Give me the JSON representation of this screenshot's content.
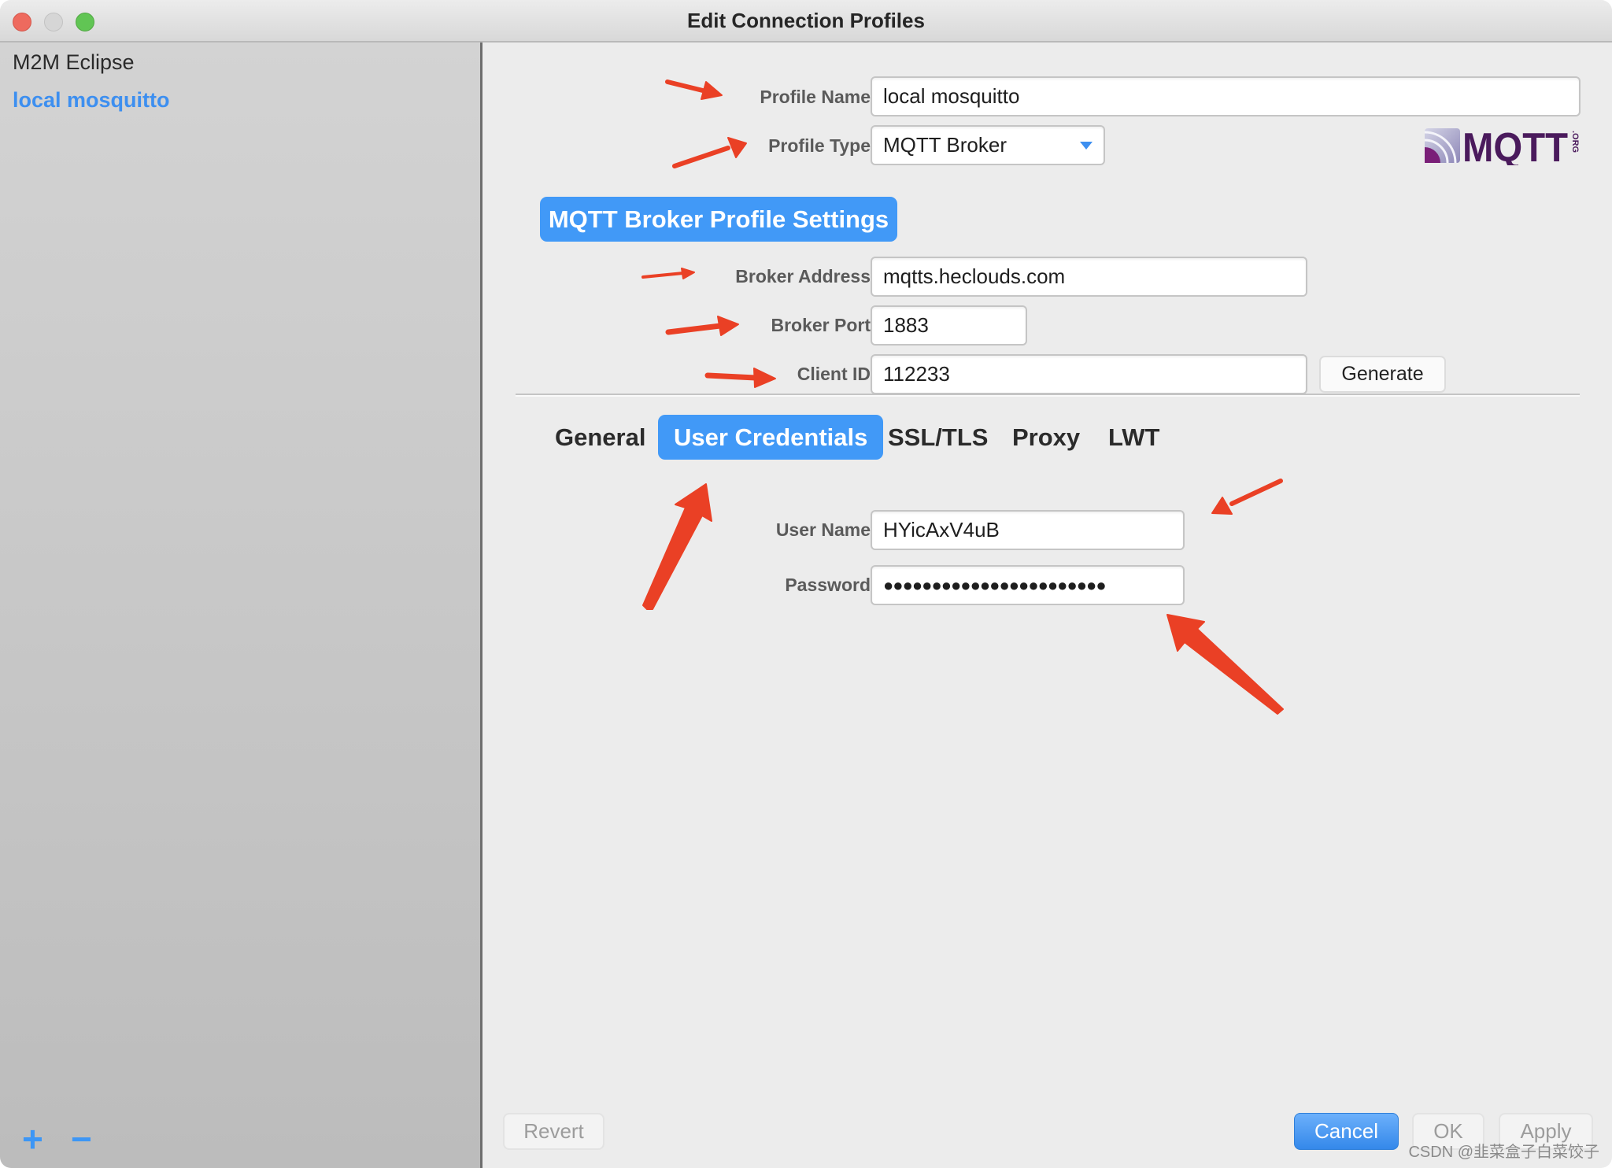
{
  "window": {
    "title": "Edit Connection Profiles",
    "traffic_lights": [
      "close",
      "minimize",
      "zoom"
    ]
  },
  "sidebar": {
    "items": [
      {
        "label": "M2M Eclipse",
        "selected": false
      },
      {
        "label": "local mosquitto",
        "selected": true
      }
    ],
    "add_icon": "+",
    "remove_icon": "−"
  },
  "profile": {
    "name_label": "Profile Name",
    "name_value": "local mosquitto",
    "type_label": "Profile Type",
    "type_value": "MQTT Broker",
    "logo_text": "MQTT",
    "logo_suffix": ".ORG"
  },
  "broker": {
    "section_title": "MQTT Broker Profile Settings",
    "address_label": "Broker Address",
    "address_value": "mqtts.heclouds.com",
    "port_label": "Broker Port",
    "port_value": "1883",
    "client_id_label": "Client ID",
    "client_id_value": "112233",
    "generate_label": "Generate"
  },
  "tabs": [
    {
      "label": "General",
      "active": false
    },
    {
      "label": "User Credentials",
      "active": true
    },
    {
      "label": "SSL/TLS",
      "active": false
    },
    {
      "label": "Proxy",
      "active": false
    },
    {
      "label": "LWT",
      "active": false
    }
  ],
  "credentials": {
    "user_name_label": "User Name",
    "user_name_value": "HYicAxV4uB",
    "password_label": "Password",
    "password_value": "●●●●●●●●●●●●●●●●●●●●●●●"
  },
  "footer": {
    "revert_label": "Revert",
    "cancel_label": "Cancel",
    "ok_label": "OK",
    "apply_label": "Apply"
  },
  "watermark": "CSDN @韭菜盒子白菜饺子",
  "colors": {
    "accent": "#4199f7",
    "annotation_arrow": "#ea4025",
    "logo_purple": "#4a1a5c"
  }
}
